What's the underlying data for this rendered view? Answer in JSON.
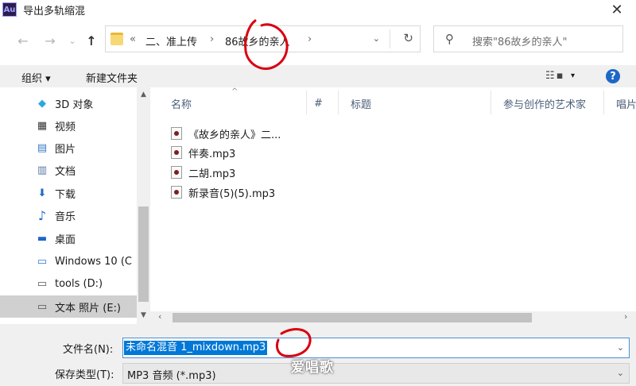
{
  "window": {
    "app_icon_text": "Au",
    "title": "导出多轨缩混",
    "close_glyph": "✕"
  },
  "nav": {
    "back": "←",
    "forward": "→",
    "up_dropdown": "⌄",
    "up": "↑",
    "address": {
      "overflow": "«",
      "crumbs": [
        "二、准上传",
        "›",
        "86故乡的亲人",
        "›"
      ],
      "dropdown": "⌄",
      "refresh": "↻"
    },
    "search_placeholder": "搜索\"86故乡的亲人\""
  },
  "toolbar": {
    "organize_label": "组织 ▾",
    "new_folder_label": "新建文件夹",
    "view_glyph": "☷ ▪",
    "view_dropdown": "▾",
    "help_label": "?"
  },
  "sidebar": {
    "items": [
      {
        "label": "3D 对象",
        "icon": "cube-icon",
        "glyph": "◆",
        "color": "#2aa8e0"
      },
      {
        "label": "视频",
        "icon": "film-icon",
        "glyph": "▦",
        "color": "#333333"
      },
      {
        "label": "图片",
        "icon": "picture-icon",
        "glyph": "▤",
        "color": "#3a7bbf"
      },
      {
        "label": "文档",
        "icon": "document-icon",
        "glyph": "▥",
        "color": "#5a7aa8"
      },
      {
        "label": "下载",
        "icon": "download-icon",
        "glyph": "⬇",
        "color": "#1d68c7"
      },
      {
        "label": "音乐",
        "icon": "music-icon",
        "glyph": "♪",
        "color": "#1d68c7"
      },
      {
        "label": "桌面",
        "icon": "desktop-icon",
        "glyph": "▬",
        "color": "#1d68c7"
      },
      {
        "label": "Windows 10 (C",
        "icon": "windows-drive-icon",
        "glyph": "▭",
        "color": "#555555"
      },
      {
        "label": "tools (D:)",
        "icon": "drive-icon",
        "glyph": "▭",
        "color": "#555555"
      },
      {
        "label": "文本 照片 (E:)",
        "icon": "drive-icon",
        "glyph": "▭",
        "color": "#555555"
      },
      {
        "label": "...",
        "icon": "drive-icon",
        "glyph": "▭",
        "color": "#555555"
      }
    ],
    "selected_index": 9
  },
  "scroll": {
    "up": "▲",
    "down": "▼",
    "left": "‹",
    "right": "›"
  },
  "columns": [
    "名称",
    "#",
    "标题",
    "参与创作的艺术家",
    "唱片"
  ],
  "sort_indicator": "^",
  "files": [
    "《故乡的亲人》二...",
    "伴奏.mp3",
    "二胡.mp3",
    "新录音(5)(5).mp3"
  ],
  "bottom": {
    "filename_label": "文件名(N):",
    "filename_value": "未命名混音 1_mixdown.mp3",
    "filetype_label": "保存类型(T):",
    "filetype_value": "MP3 音频 (*.mp3)",
    "dropdown": "⌄"
  },
  "watermark": "爱唱歌",
  "colors": {
    "accent": "#0078d7",
    "help": "#1d68c7",
    "annotation_red": "#d9000f"
  }
}
